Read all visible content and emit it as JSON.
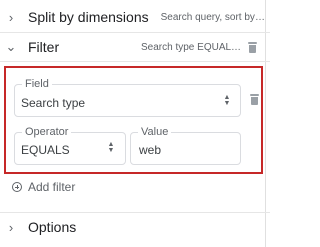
{
  "split": {
    "title": "Split by dimensions",
    "summary": "Search query, sort by cli..."
  },
  "filter": {
    "title": "Filter",
    "summary": "Search type EQUALS web",
    "field": {
      "label": "Field",
      "value": "Search type"
    },
    "operator": {
      "label": "Operator",
      "value": "EQUALS"
    },
    "value": {
      "label": "Value",
      "value": "web"
    },
    "add_filter": "Add filter"
  },
  "options": {
    "title": "Options"
  },
  "icons": {
    "collapsed": "chevron-right-icon",
    "expanded": "chevron-down-icon",
    "delete": "trash-icon",
    "select": "unfold-icon",
    "add": "add-circle-icon"
  },
  "colors": {
    "highlight": "#c62828",
    "border": "#dadce0"
  }
}
